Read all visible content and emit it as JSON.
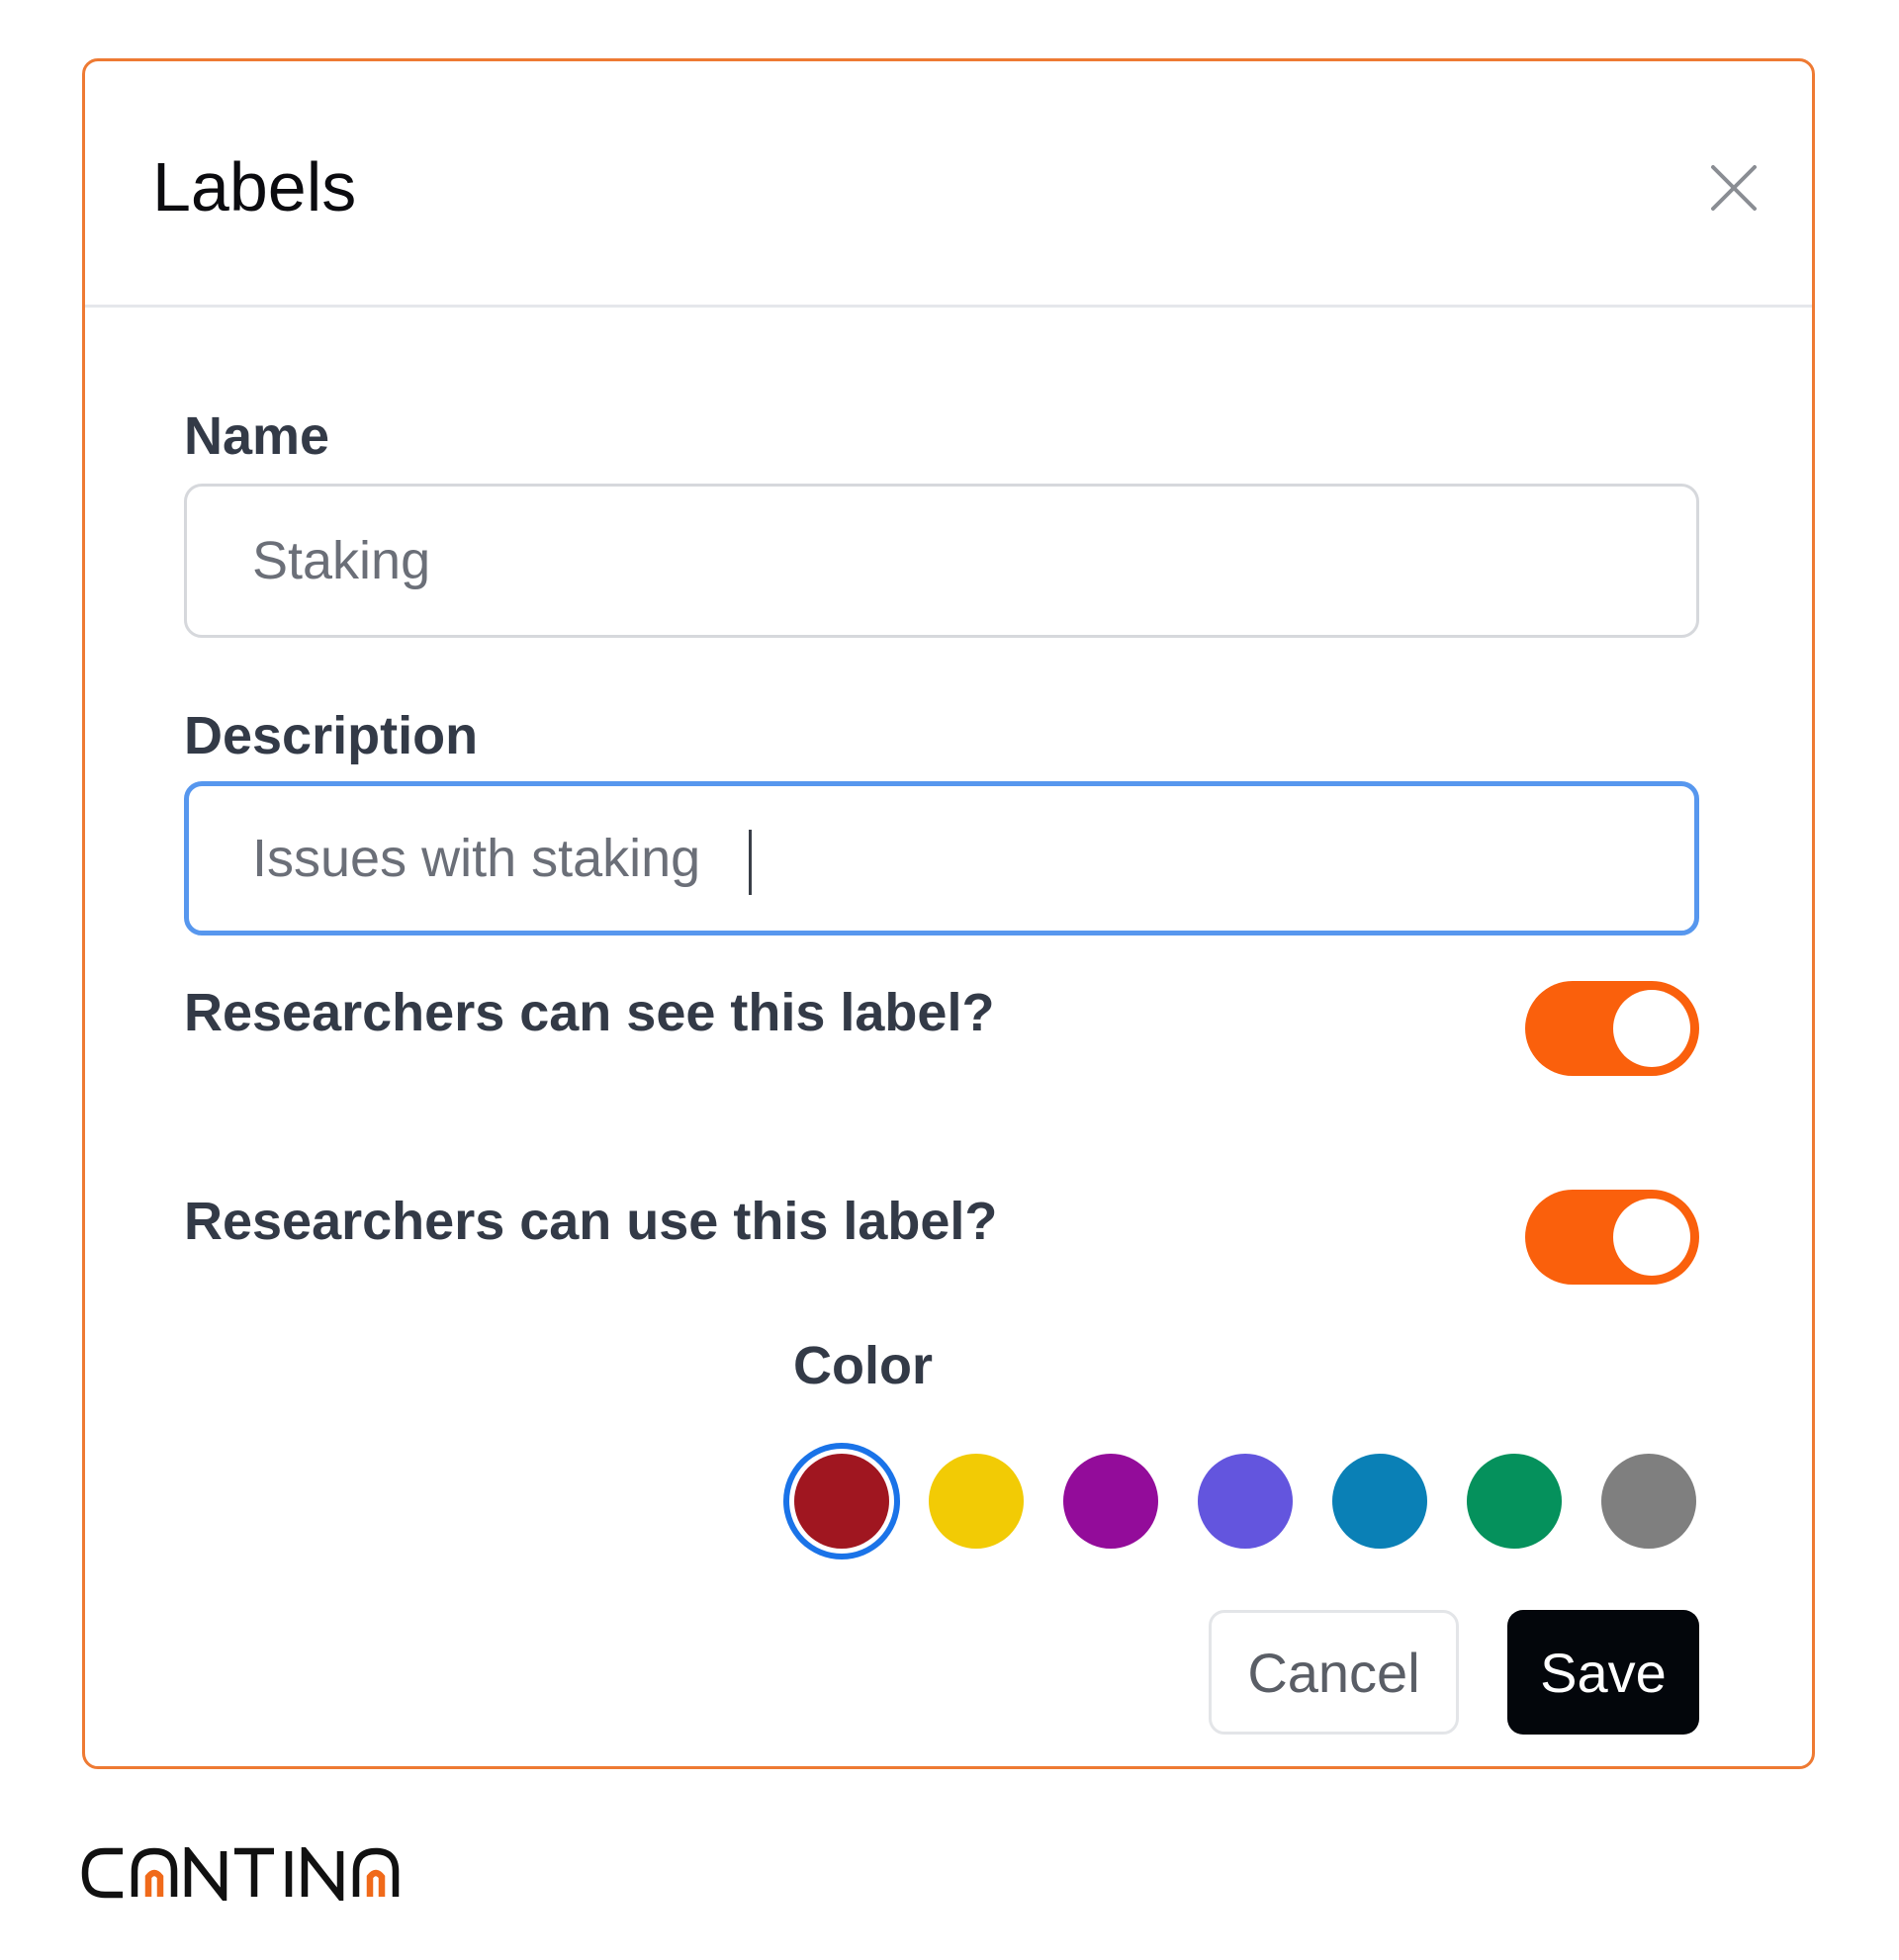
{
  "dialog": {
    "title": "Labels",
    "close_icon": "close-icon"
  },
  "form": {
    "name_label": "Name",
    "name_value": "Staking",
    "description_label": "Description",
    "description_value": "Issues with staking",
    "visibility_label": "Researchers can see this label?",
    "visibility_enabled": true,
    "usage_label": "Researchers can use this label?",
    "usage_enabled": true,
    "color_label": "Color",
    "colors": [
      "#a01620",
      "#f2cb05",
      "#930c9a",
      "#6355de",
      "#0a80b6",
      "#05915c",
      "#7f7f7f"
    ],
    "selected_color_index": 0,
    "toggle_on_color": "#fa600c"
  },
  "actions": {
    "cancel_label": "Cancel",
    "save_label": "Save"
  },
  "brand": {
    "name": "CANTINA",
    "accent_color": "#f06a1a"
  }
}
